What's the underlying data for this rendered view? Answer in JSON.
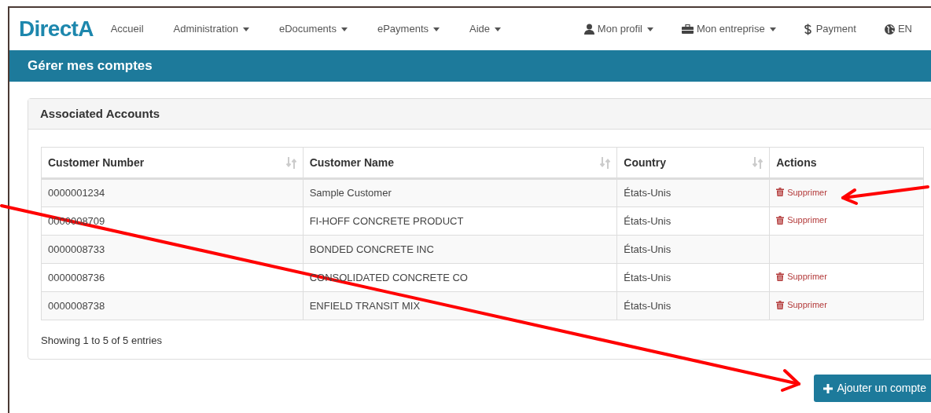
{
  "logo": "DirectA",
  "nav_left": [
    {
      "label": "Accueil",
      "dropdown": false
    },
    {
      "label": "Administration",
      "dropdown": true
    },
    {
      "label": "eDocuments",
      "dropdown": true
    },
    {
      "label": "ePayments",
      "dropdown": true
    },
    {
      "label": "Aide",
      "dropdown": true
    }
  ],
  "nav_right": [
    {
      "label": "Mon profil",
      "kind": "user",
      "dropdown": true
    },
    {
      "label": "Mon entreprise",
      "kind": "briefcase",
      "dropdown": true
    },
    {
      "label": "Payment",
      "kind": "dollar",
      "dropdown": false
    },
    {
      "label": "EN",
      "kind": "globe",
      "dropdown": false
    }
  ],
  "page_title": "Gérer mes comptes",
  "panel": {
    "title": "Associated Accounts",
    "table": {
      "columns": [
        {
          "label": "Customer Number",
          "sortable": true
        },
        {
          "label": "Customer Name",
          "sortable": true
        },
        {
          "label": "Country",
          "sortable": true
        },
        {
          "label": "Actions",
          "sortable": false
        }
      ],
      "rows": [
        {
          "cells": [
            "0000001234",
            "Sample Customer",
            "États-Unis"
          ],
          "action": "Supprimer"
        },
        {
          "cells": [
            "0000008709",
            "FI-HOFF CONCRETE PRODUCT",
            "États-Unis"
          ],
          "action": "Supprimer"
        },
        {
          "cells": [
            "0000008733",
            "BONDED CONCRETE INC",
            "États-Unis"
          ]
        },
        {
          "cells": [
            "0000008736",
            "CONSOLIDATED CONCRETE CO",
            "États-Unis"
          ],
          "action": "Supprimer"
        },
        {
          "cells": [
            "0000008738",
            "ENFIELD TRANSIT MIX",
            "États-Unis"
          ],
          "action": "Supprimer"
        }
      ]
    },
    "info": "Showing 1 to 5 of 5 entries"
  },
  "add_button": "Ajouter un compte"
}
